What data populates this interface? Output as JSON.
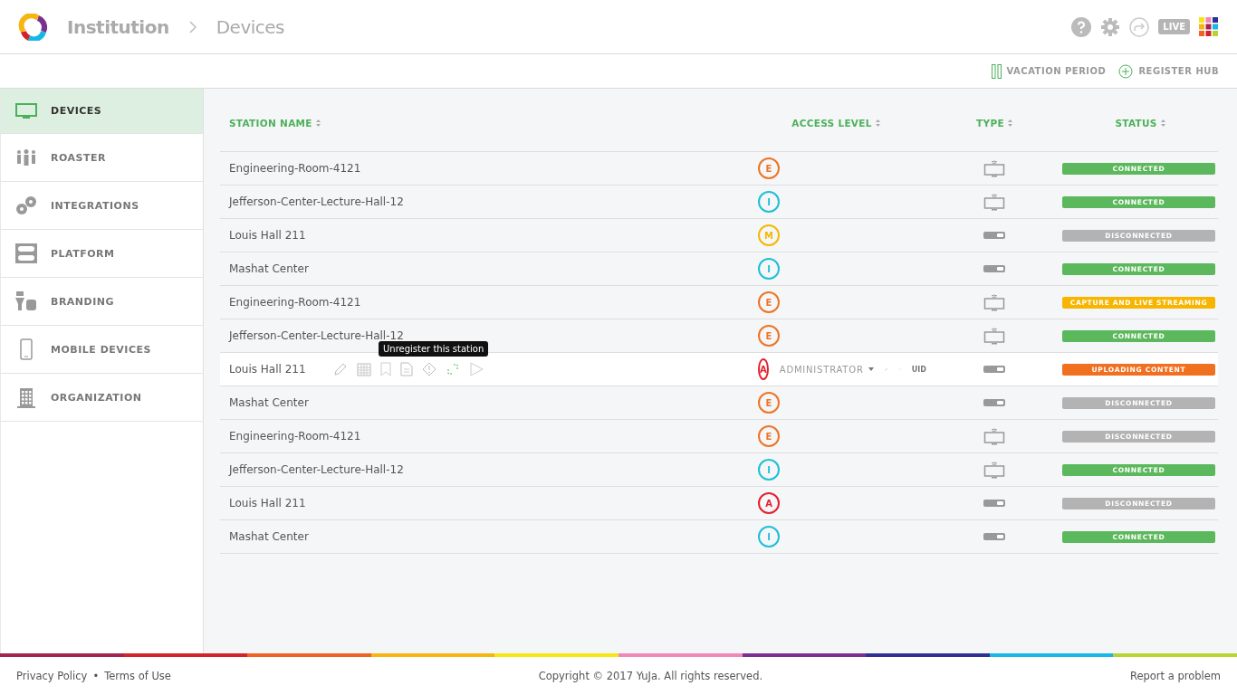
{
  "header": {
    "breadcrumb": [
      "Institution",
      "Devices"
    ],
    "live": "LIVE"
  },
  "toolbar": [
    "VACATION PERIOD",
    "REGISTER HUB"
  ],
  "sidebar": {
    "items": [
      {
        "label": "DEVICES",
        "selected": true
      },
      {
        "label": "ROASTER",
        "selected": false
      },
      {
        "label": "INTEGRATIONS",
        "selected": false
      },
      {
        "label": "PLATFORM",
        "selected": false
      },
      {
        "label": "BRANDING",
        "selected": false
      },
      {
        "label": "MOBILE DEVICES",
        "selected": false
      },
      {
        "label": "ORGANIZATION",
        "selected": false
      }
    ]
  },
  "table": {
    "columns": [
      "STATION NAME",
      "ACCESS LEVEL",
      "TYPE",
      "STATUS"
    ],
    "rows": [
      {
        "name": "Engineering-Room-4121",
        "kind": "monitor",
        "access": {
          "label": "E",
          "color": "#ee7425"
        },
        "status": {
          "label": "CONNECTED",
          "color": "#5cb85c"
        }
      },
      {
        "name": "Jefferson-Center-Lecture-Hall-12",
        "kind": "monitor",
        "access": {
          "label": "I",
          "color": "#1fbfd6"
        },
        "status": {
          "label": "CONNECTED",
          "color": "#5cb85c"
        }
      },
      {
        "name": "Louis Hall 211",
        "kind": "hub",
        "access": {
          "label": "M",
          "color": "#f5b800"
        },
        "status": {
          "label": "DISCONNECTED",
          "color": "#b3b3b3"
        }
      },
      {
        "name": "Mashat Center",
        "kind": "hub",
        "access": {
          "label": "I",
          "color": "#1fbfd6"
        },
        "status": {
          "label": "CONNECTED",
          "color": "#5cb85c"
        }
      },
      {
        "name": "Engineering-Room-4121",
        "kind": "monitor",
        "access": {
          "label": "E",
          "color": "#ee7425"
        },
        "status": {
          "label": "CAPTURE AND LIVE STREAMING",
          "color": "#f7b500"
        }
      },
      {
        "name": "Jefferson-Center-Lecture-Hall-12",
        "kind": "monitor",
        "access": {
          "label": "E",
          "color": "#ee7425"
        },
        "status": {
          "label": "CONNECTED",
          "color": "#5cb85c"
        }
      },
      {
        "name": "Louis Hall 211",
        "kind": "hub",
        "access": {
          "label": "A",
          "color": "#e5202e"
        },
        "status": {
          "label": "UPLOADING CONTENT",
          "color": "#f07020"
        },
        "editor": {
          "tooltip": "Unregister this station",
          "role": "ADMINISTRATOR",
          "uid": "UID"
        }
      },
      {
        "name": "Mashat Center",
        "kind": "hub",
        "access": {
          "label": "E",
          "color": "#ee7425"
        },
        "status": {
          "label": "DISCONNECTED",
          "color": "#b3b3b3"
        }
      },
      {
        "name": "Engineering-Room-4121",
        "kind": "monitor",
        "access": {
          "label": "E",
          "color": "#ee7425"
        },
        "status": {
          "label": "DISCONNECTED",
          "color": "#b3b3b3"
        }
      },
      {
        "name": "Jefferson-Center-Lecture-Hall-12",
        "kind": "monitor",
        "access": {
          "label": "I",
          "color": "#1fbfd6"
        },
        "status": {
          "label": "CONNECTED",
          "color": "#5cb85c"
        }
      },
      {
        "name": "Louis Hall 211",
        "kind": "hub",
        "access": {
          "label": "A",
          "color": "#e5202e"
        },
        "status": {
          "label": "DISCONNECTED",
          "color": "#b3b3b3"
        }
      },
      {
        "name": "Mashat Center",
        "kind": "hub",
        "access": {
          "label": "I",
          "color": "#1fbfd6"
        },
        "status": {
          "label": "CONNECTED",
          "color": "#5cb85c"
        }
      }
    ]
  },
  "footer": {
    "links": [
      "Privacy Policy",
      "Terms of Use"
    ],
    "separator": "•",
    "copyright": "Copyright © 2017 YuJa. All rights reserved.",
    "report": "Report a problem"
  }
}
